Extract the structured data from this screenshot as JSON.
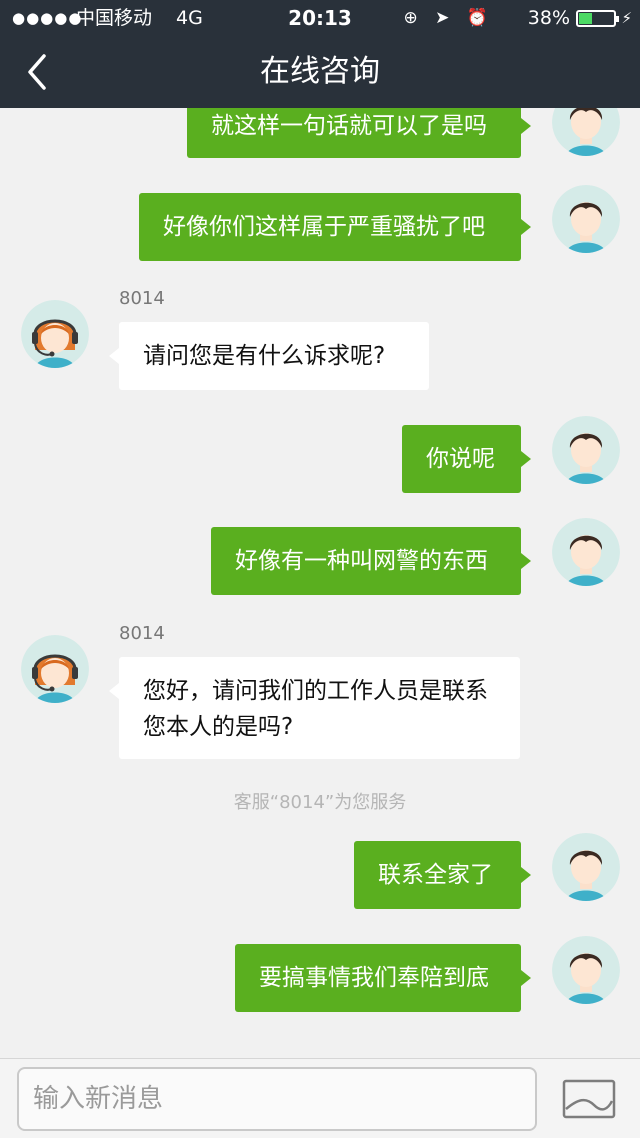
{
  "status_bar": {
    "signal": "●●●●●",
    "carrier": "中国移动",
    "network": "4G",
    "time": "20:13",
    "icons": "⊕ ➤ ⏰",
    "battery": "38%",
    "battery_level": 0.38
  },
  "nav": {
    "title": "在线咨询",
    "back_icon": "chevron-left-icon"
  },
  "messages": [
    {
      "dir": "out",
      "text": "就这样一句话就可以了是吗"
    },
    {
      "dir": "out",
      "text": "好像你们这样属于严重骚扰了吧"
    },
    {
      "dir": "in",
      "sender": "8014",
      "text": "请问您是有什么诉求呢?"
    },
    {
      "dir": "out",
      "text": "你说呢"
    },
    {
      "dir": "out",
      "text": "好像有一种叫网警的东西"
    },
    {
      "dir": "in",
      "sender": "8014",
      "text": "您好，请问我们的工作人员是联系您本人的是吗?"
    },
    {
      "dir": "out",
      "text": "联系全家了"
    },
    {
      "dir": "out",
      "text": "要搞事情我们奉陪到底"
    }
  ],
  "notice": "客服“8014”为您服务",
  "input": {
    "placeholder": "输入新消息",
    "value": ""
  },
  "colors": {
    "header": "#29313a",
    "outgoing_bubble": "#5aaf1f",
    "incoming_bubble": "#ffffff",
    "background": "#f1f1f1"
  }
}
